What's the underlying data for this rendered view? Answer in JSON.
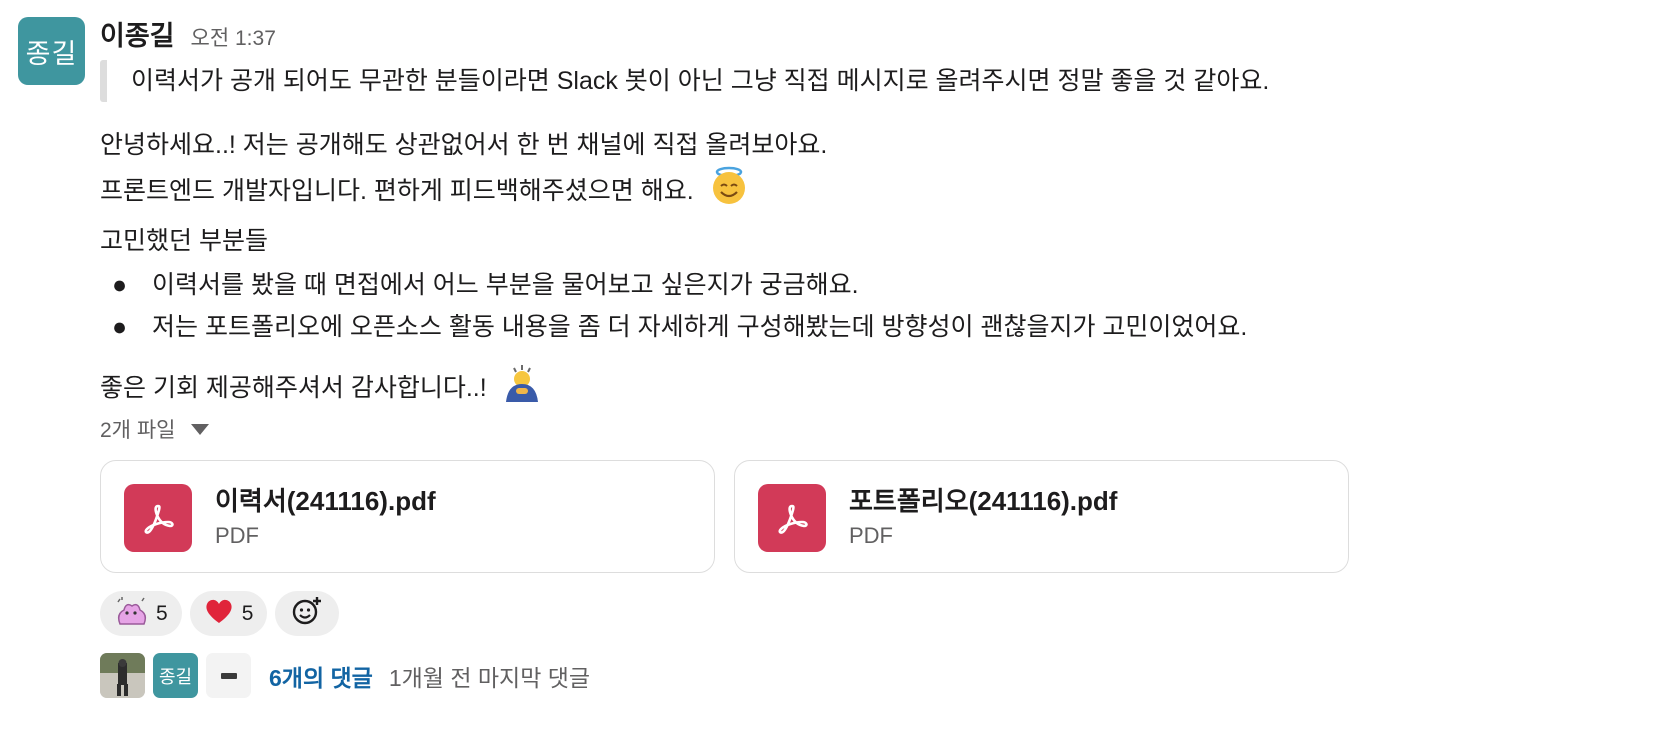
{
  "avatar": {
    "label": "종길",
    "color": "#3f969f"
  },
  "message": {
    "author": "이종길",
    "time": "오전 1:37",
    "quote": "이력서가 공개 되어도 무관한 분들이라면 Slack 봇이 아닌 그냥 직접 메시지로 올려주시면 정말 좋을 것 같아요.",
    "line1": "안녕하세요..! 저는 공개해도 상관없어서 한 번 채널에 직접 올려보아요.",
    "line2": "프론트엔드 개발자입니다. 편하게 피드백해주셨으면 해요.",
    "line2_emoji": "smiling-face-with-halo",
    "section_title": "고민했던 부분들",
    "bullets": [
      "이력서를 봤을 때 면접에서 어느 부분을 물어보고 싶은지가 궁금해요.",
      "저는 포트폴리오에 오픈소스 활동 내용을 좀 더 자세하게 구성해봤는데 방향성이 괜찮을지가 고민이었어요."
    ],
    "closing": "좋은 기회 제공해주셔서 감사합니다..!",
    "closing_emoji": "person-bowing"
  },
  "files": {
    "toggle_label": "2개 파일",
    "items": [
      {
        "name": "이력서(241116).pdf",
        "type": "PDF"
      },
      {
        "name": "포트폴리오(241116).pdf",
        "type": "PDF"
      }
    ],
    "icon_color": "#d23a58"
  },
  "reactions": [
    {
      "emoji": "pink-blob-emoji",
      "count": "5"
    },
    {
      "emoji": "red-heart",
      "count": "5"
    }
  ],
  "thread": {
    "avatar_label": "종길",
    "reply_count": "6개의 댓글",
    "last_reply": "1개월 전 마지막 댓글",
    "link_color": "#1264a3"
  }
}
